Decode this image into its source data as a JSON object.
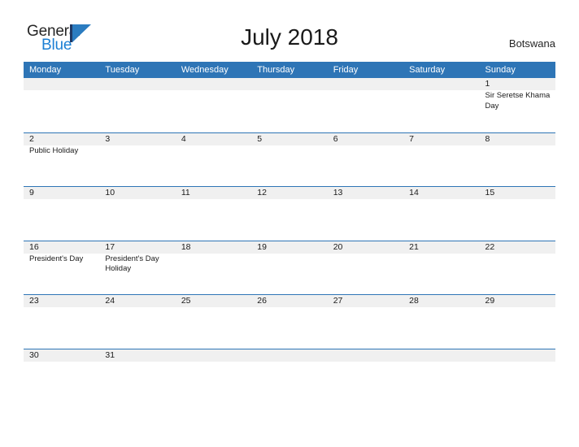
{
  "brand": {
    "word_one": "General",
    "word_two": "Blue",
    "mark": "triangle-flag-icon",
    "accent_color": "#2b7cc0",
    "dark_color": "#1f3864"
  },
  "header": {
    "title": "July 2018",
    "country": "Botswana"
  },
  "theme": {
    "header_blue": "#2e75b6",
    "row_rule_blue": "#2e75b6",
    "number_strip_gray": "#f0f0f0",
    "text_color": "#1a1a1a"
  },
  "calendar": {
    "month": "July",
    "year": "2018",
    "weekday_headers": [
      "Monday",
      "Tuesday",
      "Wednesday",
      "Thursday",
      "Friday",
      "Saturday",
      "Sunday"
    ],
    "weeks": [
      {
        "days": [
          {
            "date": "",
            "event": ""
          },
          {
            "date": "",
            "event": ""
          },
          {
            "date": "",
            "event": ""
          },
          {
            "date": "",
            "event": ""
          },
          {
            "date": "",
            "event": ""
          },
          {
            "date": "",
            "event": ""
          },
          {
            "date": "1",
            "event": "Sir Seretse Khama Day"
          }
        ]
      },
      {
        "days": [
          {
            "date": "2",
            "event": "Public Holiday"
          },
          {
            "date": "3",
            "event": ""
          },
          {
            "date": "4",
            "event": ""
          },
          {
            "date": "5",
            "event": ""
          },
          {
            "date": "6",
            "event": ""
          },
          {
            "date": "7",
            "event": ""
          },
          {
            "date": "8",
            "event": ""
          }
        ]
      },
      {
        "days": [
          {
            "date": "9",
            "event": ""
          },
          {
            "date": "10",
            "event": ""
          },
          {
            "date": "11",
            "event": ""
          },
          {
            "date": "12",
            "event": ""
          },
          {
            "date": "13",
            "event": ""
          },
          {
            "date": "14",
            "event": ""
          },
          {
            "date": "15",
            "event": ""
          }
        ]
      },
      {
        "days": [
          {
            "date": "16",
            "event": "President's Day"
          },
          {
            "date": "17",
            "event": "President's Day Holiday"
          },
          {
            "date": "18",
            "event": ""
          },
          {
            "date": "19",
            "event": ""
          },
          {
            "date": "20",
            "event": ""
          },
          {
            "date": "21",
            "event": ""
          },
          {
            "date": "22",
            "event": ""
          }
        ]
      },
      {
        "days": [
          {
            "date": "23",
            "event": ""
          },
          {
            "date": "24",
            "event": ""
          },
          {
            "date": "25",
            "event": ""
          },
          {
            "date": "26",
            "event": ""
          },
          {
            "date": "27",
            "event": ""
          },
          {
            "date": "28",
            "event": ""
          },
          {
            "date": "29",
            "event": ""
          }
        ]
      },
      {
        "days": [
          {
            "date": "30",
            "event": ""
          },
          {
            "date": "31",
            "event": ""
          },
          {
            "date": "",
            "event": ""
          },
          {
            "date": "",
            "event": ""
          },
          {
            "date": "",
            "event": ""
          },
          {
            "date": "",
            "event": ""
          },
          {
            "date": "",
            "event": ""
          }
        ]
      }
    ]
  }
}
